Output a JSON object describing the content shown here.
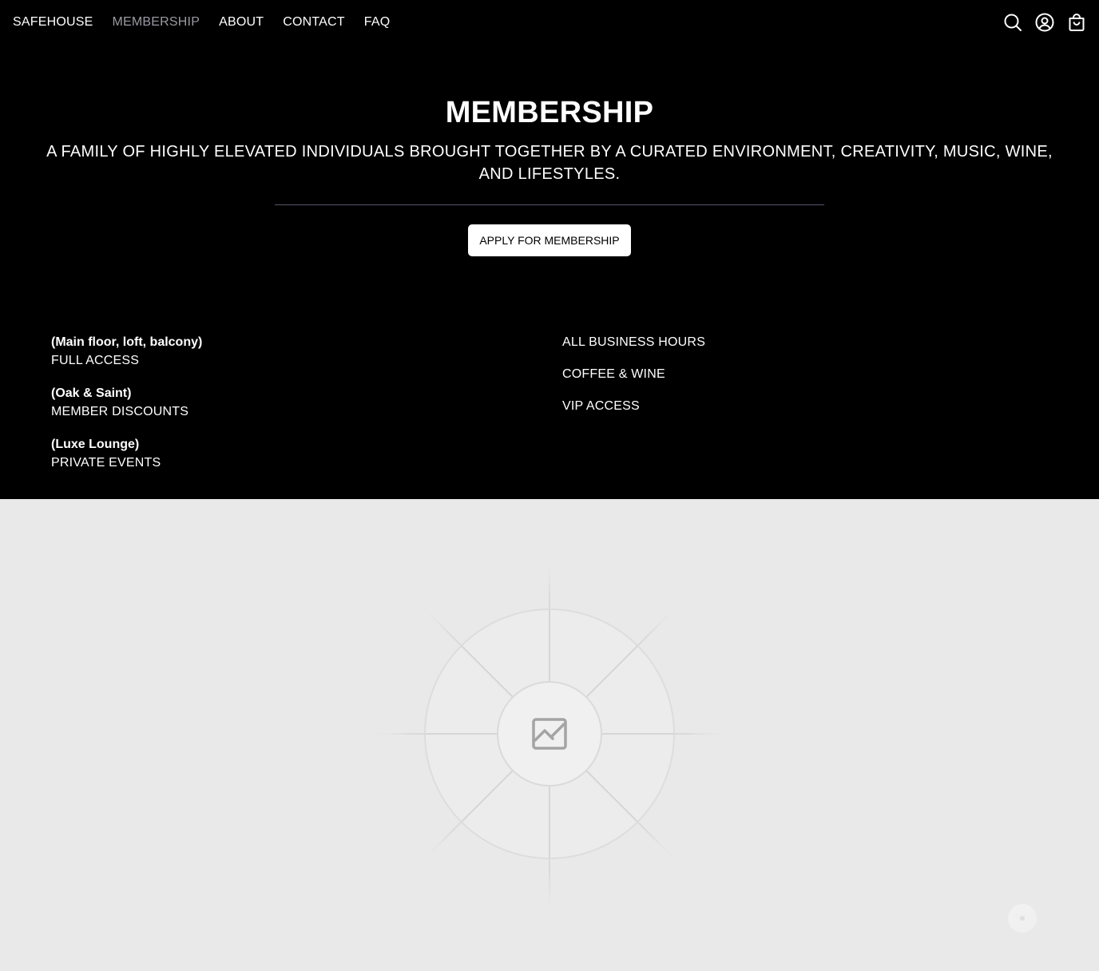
{
  "nav": {
    "items": [
      {
        "label": "SAFEHOUSE"
      },
      {
        "label": "MEMBERSHIP"
      },
      {
        "label": "ABOUT"
      },
      {
        "label": "CONTACT"
      },
      {
        "label": "FAQ"
      }
    ]
  },
  "hero": {
    "title": "MEMBERSHIP",
    "subtitle": "A FAMILY OF HIGHLY ELEVATED INDIVIDUALS BROUGHT TOGETHER BY A CURATED ENVIRONMENT, CREATIVITY, MUSIC, WINE, AND LIFESTYLES.",
    "apply_label": "APPLY FOR MEMBERSHIP"
  },
  "features": {
    "left": [
      {
        "note": "(Main floor, loft, balcony)",
        "label": "FULL ACCESS"
      },
      {
        "note": "(Oak & Saint)",
        "label": "MEMBER DISCOUNTS"
      },
      {
        "note": "(Luxe Lounge)",
        "label": "PRIVATE EVENTS"
      }
    ],
    "right": [
      {
        "label": "ALL BUSINESS HOURS"
      },
      {
        "label": "COFFEE & WINE"
      },
      {
        "label": "VIP ACCESS"
      }
    ]
  },
  "icons": {
    "search": "search-icon",
    "account": "account-icon",
    "cart": "cart-icon",
    "image_placeholder": "image-placeholder-icon"
  },
  "colors": {
    "background": "#000000",
    "nav_active": "#9a9aa4",
    "placeholder_bg": "#e9e9e9"
  }
}
